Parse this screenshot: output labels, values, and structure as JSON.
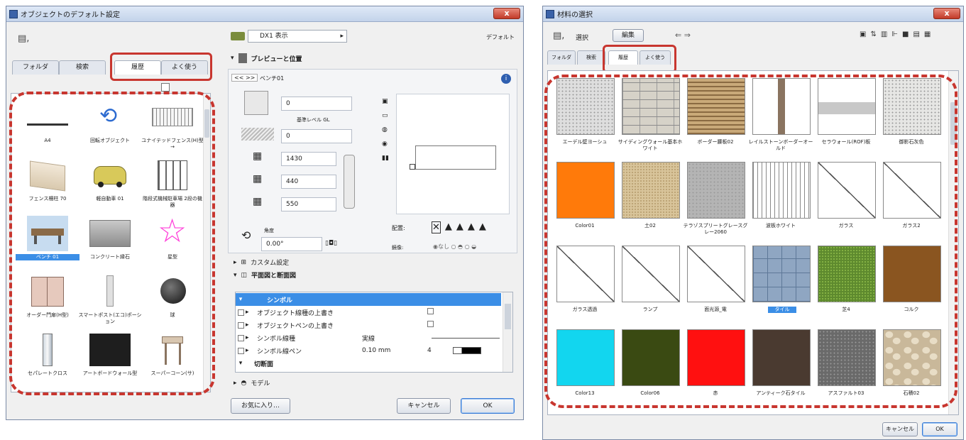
{
  "left": {
    "title": "オブジェクトのデフォルト設定",
    "close_label": "x",
    "view_menu": "▤,",
    "tabs": [
      {
        "label": "フォルダ",
        "active": false
      },
      {
        "label": "検索",
        "active": false
      },
      {
        "label": "履歴",
        "active": true
      },
      {
        "label": "よく使う",
        "active": false
      }
    ],
    "library_items": [
      {
        "label": "A4",
        "icon": "line-object-icon"
      },
      {
        "label": "回転オブジェクト",
        "icon": "rotate-object-icon"
      },
      {
        "label": "ユナイテッドフェンス(H)型→",
        "icon": "fence-icon"
      },
      {
        "label": "フェンス柵柱 70",
        "icon": "wall-fence-icon"
      },
      {
        "label": "軽自動車 01",
        "icon": "car-icon"
      },
      {
        "label": "階段式機械駐車場 2段の機器",
        "icon": "parking-lift-icon"
      },
      {
        "label": "ベンチ 01",
        "icon": "bench-icon",
        "selected": true
      },
      {
        "label": "コンクリート縁石",
        "icon": "curb-icon"
      },
      {
        "label": "星型",
        "icon": "star-icon"
      },
      {
        "label": "オーダー門扉(H型)",
        "icon": "gate-icon"
      },
      {
        "label": "スマートポスト(エコ)ポーション",
        "icon": "post-icon"
      },
      {
        "label": "球",
        "icon": "sphere-icon"
      },
      {
        "label": "セパレートクロス",
        "icon": "pillar-icon"
      },
      {
        "label": "アートボードウォール型",
        "icon": "dark-board-icon"
      },
      {
        "label": "スーパーコーン(サ)",
        "icon": "sign-stand-icon"
      }
    ],
    "layer_select": "DX1 表示",
    "default_label": "デフォルト",
    "preview_section": "プレビューと位置",
    "nav_buttons": "<< >>",
    "object_name": "ベンチ01",
    "elevation_value": "0",
    "ref_level_label": "基準レベル GL",
    "offset_value": "0",
    "dim_a": "1430",
    "dim_b": "440",
    "dim_c": "550",
    "angle_label": "角度",
    "angle_value": "0.00°",
    "anchor_label": "配置:",
    "mirror_label": "鏡像:",
    "mirror_options": "◉なし ○ ◓ ○ ◒",
    "custom_section": "カスタム設定",
    "plan_section": "平面図と断面図",
    "list_rows": [
      {
        "label": "シンボル",
        "value": "",
        "highlight": true,
        "expander": "▾"
      },
      {
        "label": "オブジェクト線種の上書き",
        "value": "",
        "check": true
      },
      {
        "label": "オブジェクトペンの上書き",
        "value": "",
        "check": true
      },
      {
        "label": "シンボル線種",
        "value": "実線",
        "line": true
      },
      {
        "label": "シンボル線ペン",
        "value": "0.10 mm",
        "pen": "4"
      },
      {
        "label": "切断面",
        "value": "",
        "expander": "▾"
      }
    ],
    "model_section": "モデル",
    "mode_button": "お気に入り…",
    "cancel": "キャンセル",
    "ok": "OK"
  },
  "right": {
    "title": "材料の選択",
    "close_label": "x",
    "view_menu": "▤,",
    "selection_label": "選択",
    "edit_button": "編集",
    "tabs": [
      {
        "label": "フォルダ",
        "active": false
      },
      {
        "label": "検索",
        "active": false
      },
      {
        "label": "履歴",
        "active": true
      },
      {
        "label": "よく使う",
        "active": false
      }
    ],
    "materials": [
      {
        "label": "エーデル壁ヨーシュ",
        "swatch": "#dedede",
        "texture": "speckle"
      },
      {
        "label": "サイディングウォール基本ホワイト",
        "swatch": "#d6d2c8",
        "texture": "brick"
      },
      {
        "label": "ボーダー腰板02",
        "swatch": "#b89a6e",
        "texture": "wood"
      },
      {
        "label": "レイルストーンボーダーオールド",
        "swatch": "#9b8a7a",
        "texture": "strip"
      },
      {
        "label": "セラウォール(ROF)板",
        "swatch": "#c8c8c8",
        "texture": "panel"
      },
      {
        "label": "御影石灰色",
        "swatch": "#e6e6e4",
        "texture": "speckle"
      },
      {
        "label": "Color01",
        "swatch": "#ff7a0a",
        "texture": "solid"
      },
      {
        "label": "土02",
        "swatch": "#d8c49a",
        "texture": "sand"
      },
      {
        "label": "テラゾスプリートグレースグレー2060",
        "swatch": "#b4b4b4",
        "texture": "speckle"
      },
      {
        "label": "波板ホワイト",
        "swatch": "#f2f2f2",
        "texture": "stripes"
      },
      {
        "label": "ガラス",
        "swatch": "#ffffff",
        "texture": "glass"
      },
      {
        "label": "ガラス2",
        "swatch": "#ffffff",
        "texture": "glass"
      },
      {
        "label": "ガラス透過",
        "swatch": "#ffffff",
        "texture": "glass"
      },
      {
        "label": "ランプ",
        "swatch": "#ffffff",
        "texture": "glass"
      },
      {
        "label": "面光源_電",
        "swatch": "#ffffff",
        "texture": "glass"
      },
      {
        "label": "タイル",
        "swatch": "#8fa6c2",
        "texture": "tile",
        "selected": true
      },
      {
        "label": "芝4",
        "swatch": "#5e8a2e",
        "texture": "grass"
      },
      {
        "label": "コルク",
        "swatch": "#8a5520",
        "texture": "solid"
      },
      {
        "label": "Color13",
        "swatch": "#12d6ef",
        "texture": "solid"
      },
      {
        "label": "Color06",
        "swatch": "#3a4a12",
        "texture": "solid"
      },
      {
        "label": "赤",
        "swatch": "#ff1010",
        "texture": "solid"
      },
      {
        "label": "アンティーク石タイル",
        "swatch": "#4a3a30",
        "texture": "solid"
      },
      {
        "label": "アスファルト03",
        "swatch": "#6a6a6a",
        "texture": "speckle"
      },
      {
        "label": "石積02",
        "swatch": "#c9b89a",
        "texture": "stones"
      }
    ],
    "cancel": "キャンセル",
    "ok": "OK"
  },
  "colors": {
    "highlight_red": "#c8362f",
    "selection_blue": "#3b8ee6",
    "title_bar": "#c3d3ea"
  }
}
